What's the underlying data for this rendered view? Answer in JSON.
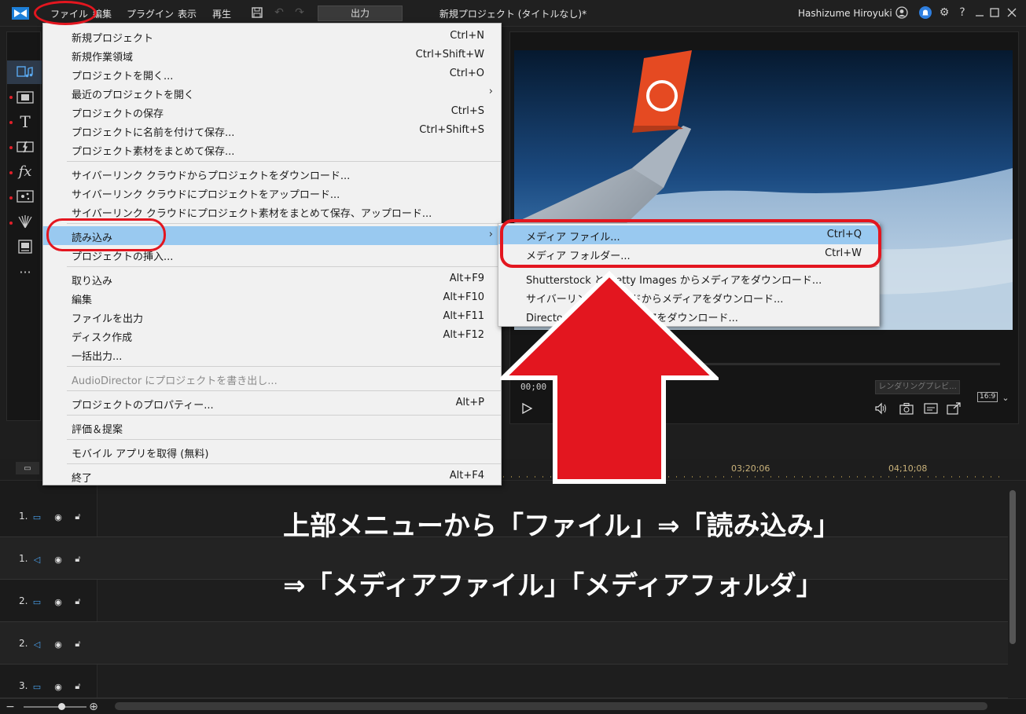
{
  "titlebar": {
    "menus": [
      "ファイル",
      "編集",
      "プラグイン",
      "表示",
      "再生"
    ],
    "output_label": "出力",
    "window_title": "新規プロジェクト (タイトルなし)*",
    "user_name": "Hashizume Hiroyuki",
    "help_glyph": "?"
  },
  "file_menu": {
    "items": [
      {
        "label": "新規プロジェクト",
        "shortcut": "Ctrl+N"
      },
      {
        "label": "新規作業領域",
        "shortcut": "Ctrl+Shift+W"
      },
      {
        "label": "プロジェクトを開く...",
        "shortcut": "Ctrl+O"
      },
      {
        "label": "最近のプロジェクトを開く",
        "shortcut": ""
      },
      {
        "label": "プロジェクトの保存",
        "shortcut": "Ctrl+S"
      },
      {
        "label": "プロジェクトに名前を付けて保存...",
        "shortcut": "Ctrl+Shift+S"
      },
      {
        "label": "プロジェクト素材をまとめて保存...",
        "shortcut": ""
      },
      {
        "label": "サイバーリンク クラウドからプロジェクトをダウンロード...",
        "shortcut": ""
      },
      {
        "label": "サイバーリンク クラウドにプロジェクトをアップロード...",
        "shortcut": ""
      },
      {
        "label": "サイバーリンク クラウドにプロジェクト素材をまとめて保存、アップロード...",
        "shortcut": ""
      },
      {
        "label": "読み込み",
        "shortcut": ""
      },
      {
        "label": "プロジェクトの挿入...",
        "shortcut": ""
      },
      {
        "label": "取り込み",
        "shortcut": "Alt+F9"
      },
      {
        "label": "編集",
        "shortcut": "Alt+F10"
      },
      {
        "label": "ファイルを出力",
        "shortcut": "Alt+F11"
      },
      {
        "label": "ディスク作成",
        "shortcut": "Alt+F12"
      },
      {
        "label": "一括出力...",
        "shortcut": ""
      },
      {
        "label": "AudioDirector にプロジェクトを書き出し...",
        "shortcut": ""
      },
      {
        "label": "プロジェクトのプロパティー...",
        "shortcut": "Alt+P"
      },
      {
        "label": "評価＆提案",
        "shortcut": ""
      },
      {
        "label": "モバイル アプリを取得 (無料)",
        "shortcut": ""
      },
      {
        "label": "終了",
        "shortcut": "Alt+F4"
      }
    ],
    "submenu_arrow": "›"
  },
  "import_submenu": {
    "items": [
      {
        "label": "メディア ファイル...",
        "shortcut": "Ctrl+Q"
      },
      {
        "label": "メディア フォルダー...",
        "shortcut": "Ctrl+W"
      },
      {
        "label": "Shutterstock と Getty Images からメディアをダウンロード...",
        "shortcut": ""
      },
      {
        "label": "サイバーリンク クラウドからメディアをダウンロード...",
        "shortcut": ""
      },
      {
        "label": "DirectorZone からメディアをダウンロード...",
        "shortcut": ""
      }
    ]
  },
  "preview": {
    "timecode": "00;00",
    "render_label": "レンダリングプレビ...",
    "aspect_ratio": "16:9"
  },
  "timeline": {
    "ruler_ticks": [
      "03;20;06",
      "04;10;08"
    ],
    "tracks": [
      {
        "label": "1.",
        "type": "video"
      },
      {
        "label": "1.",
        "type": "audio"
      },
      {
        "label": "2.",
        "type": "video"
      },
      {
        "label": "2.",
        "type": "audio"
      },
      {
        "label": "3.",
        "type": "video"
      }
    ]
  },
  "instruction": {
    "line1": "上部メニューから「ファイル」⇒「読み込み」",
    "line2": "⇒「メディアファイル」「メディアフォルダ」"
  },
  "colors": {
    "highlight": "#99c9f0",
    "annotation_red": "#e3161f",
    "menu_bg": "#f1f1f1",
    "dark_bg": "#1e1e1e"
  },
  "icons": {
    "sidebar": [
      "media-room-icon",
      "video-fx-icon",
      "title-icon",
      "transition-icon",
      "fx-icon",
      "particle-icon",
      "audio-mixer-icon",
      "subtitle-icon",
      "more-icon"
    ]
  }
}
